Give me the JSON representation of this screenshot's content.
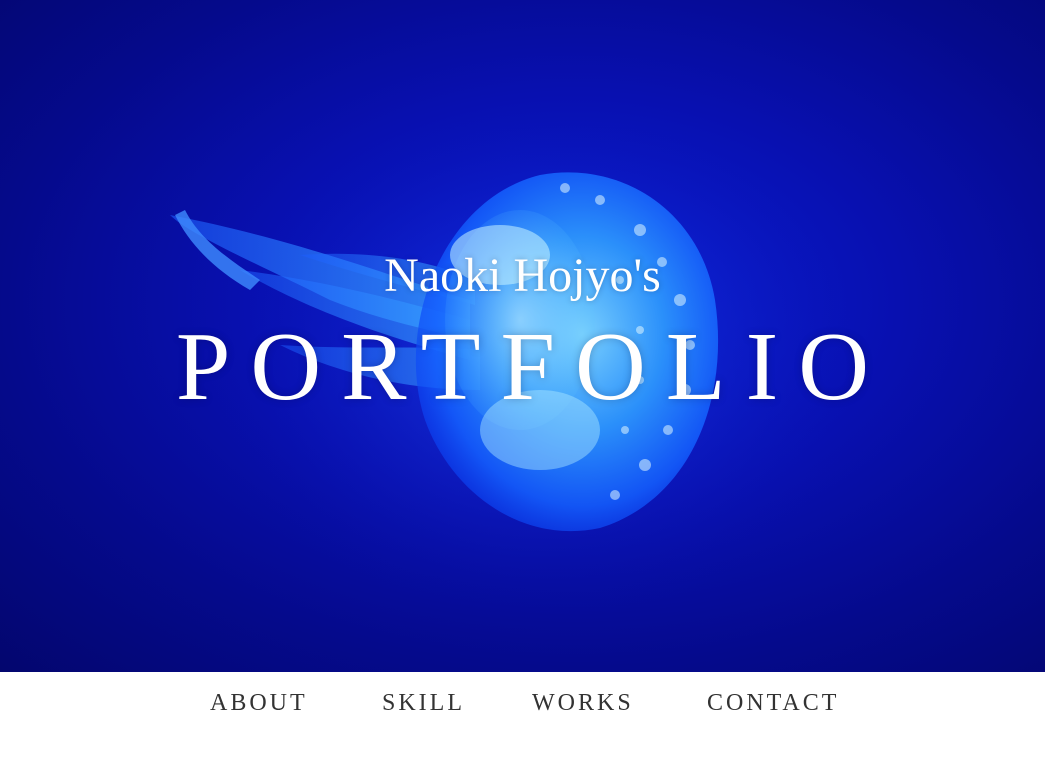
{
  "hero": {
    "subtitle": "Naoki Hojyo's",
    "title": "PORTFOLIO",
    "background_image": "jellyfish-photo",
    "background_color": "#0810b0"
  },
  "nav": {
    "items": [
      {
        "label": "ABOUT"
      },
      {
        "label": "SKILL"
      },
      {
        "label": "WORKS"
      },
      {
        "label": "CONTACT"
      }
    ],
    "text_color": "#333333"
  }
}
